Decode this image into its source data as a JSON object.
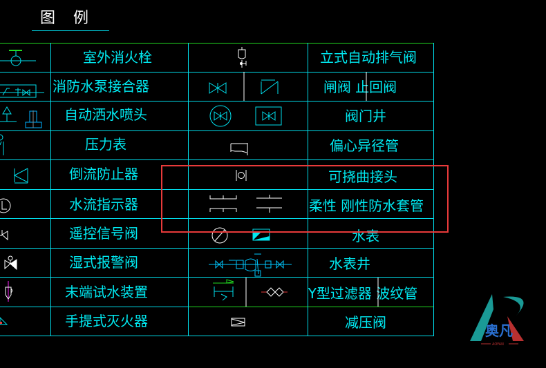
{
  "title": {
    "char1": "图",
    "char2": "例"
  },
  "colors": {
    "grid": "#00e0ee",
    "text": "#00e8f0",
    "highlight": "#e83a3a",
    "green": "#22dd22",
    "symbol_white": "#ffffff"
  },
  "left_table": [
    {
      "label": "室外消火栓",
      "symbol": "outdoor-hydrant-icon"
    },
    {
      "label": "消防水泵接合器",
      "symbol": "pump-connector-icon"
    },
    {
      "label": "自动洒水喷头",
      "symbol": "sprinkler-icon"
    },
    {
      "label": "压力表",
      "symbol": "pressure-gauge-icon"
    },
    {
      "label": "倒流防止器",
      "symbol": "backflow-preventer-icon"
    },
    {
      "label": "水流指示器",
      "symbol": "flow-indicator-icon"
    },
    {
      "label": "遥控信号阀",
      "symbol": "remote-signal-valve-icon"
    },
    {
      "label": "湿式报警阀",
      "symbol": "wet-alarm-valve-icon"
    },
    {
      "label": "末端试水装置",
      "symbol": "end-test-device-icon"
    },
    {
      "label": "手提式灭火器",
      "symbol": "portable-extinguisher-icon"
    }
  ],
  "right_table": [
    {
      "label": "立式自动排气阀",
      "symbol": "auto-air-vent-icon"
    },
    {
      "label": "闸阀    止回阀",
      "symbol": "gate-check-valve-icon"
    },
    {
      "label": "阀门井",
      "symbol": "valve-well-icon"
    },
    {
      "label": "偏心异径管",
      "symbol": "eccentric-reducer-icon"
    },
    {
      "label": "可挠曲接头",
      "symbol": "flexible-joint-icon"
    },
    {
      "label": "柔性  刚性防水套管",
      "symbol": "waterproof-sleeve-icon"
    },
    {
      "label": "水表",
      "symbol": "water-meter-icon"
    },
    {
      "label": "水表井",
      "symbol": "water-meter-well-icon"
    },
    {
      "label": "Y型过滤器  波纹管",
      "symbol": "y-strainer-bellows-icon"
    },
    {
      "label": "减压阀",
      "symbol": "pressure-reducing-valve-icon"
    }
  ],
  "logo": {
    "text": "奥凡",
    "subtext": "AOFAN"
  }
}
